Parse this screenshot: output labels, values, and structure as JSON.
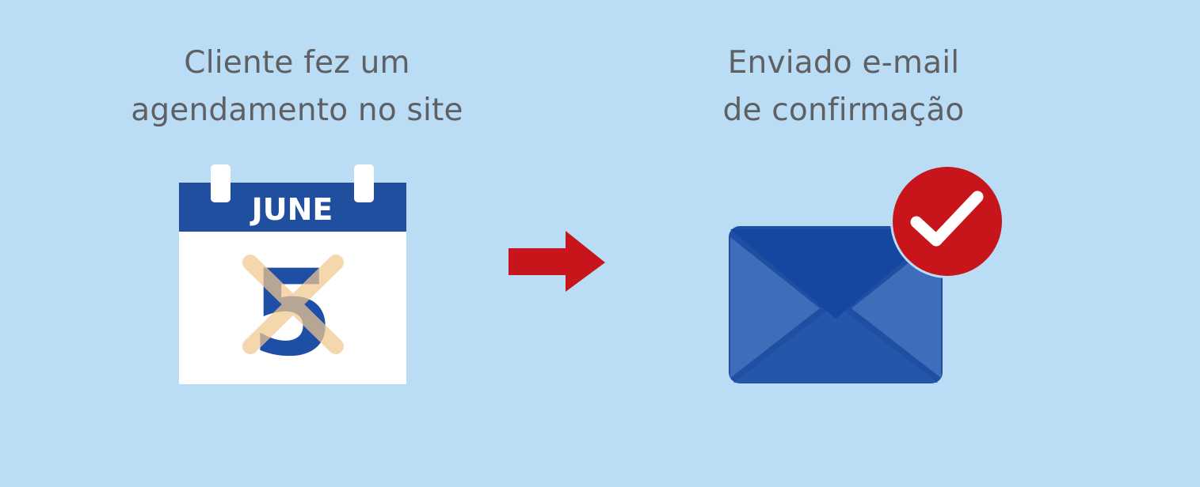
{
  "steps": [
    {
      "caption_line1": "Cliente fez um",
      "caption_line2": "agendamento no site",
      "icon": "calendar-icon",
      "calendar": {
        "month": "JUNE",
        "day": "5"
      }
    },
    {
      "caption_line1": "Enviado e-mail",
      "caption_line2": "de confirmação",
      "icon": "envelope-check-icon"
    }
  ],
  "connector_icon": "arrow-right-icon",
  "colors": {
    "background": "#badcf5",
    "caption_text": "#5e6063",
    "calendar_header": "#1f4f9e",
    "calendar_body": "#ffffff",
    "day_number": "#1e4ea5",
    "cross_mark": "#f2c88f",
    "arrow": "#c8151b",
    "envelope_dark": "#1647a0",
    "envelope_light": "#3f6db9",
    "envelope_mid": "#2656aa",
    "check_badge": "#c8151b",
    "check_mark": "#ffffff"
  }
}
